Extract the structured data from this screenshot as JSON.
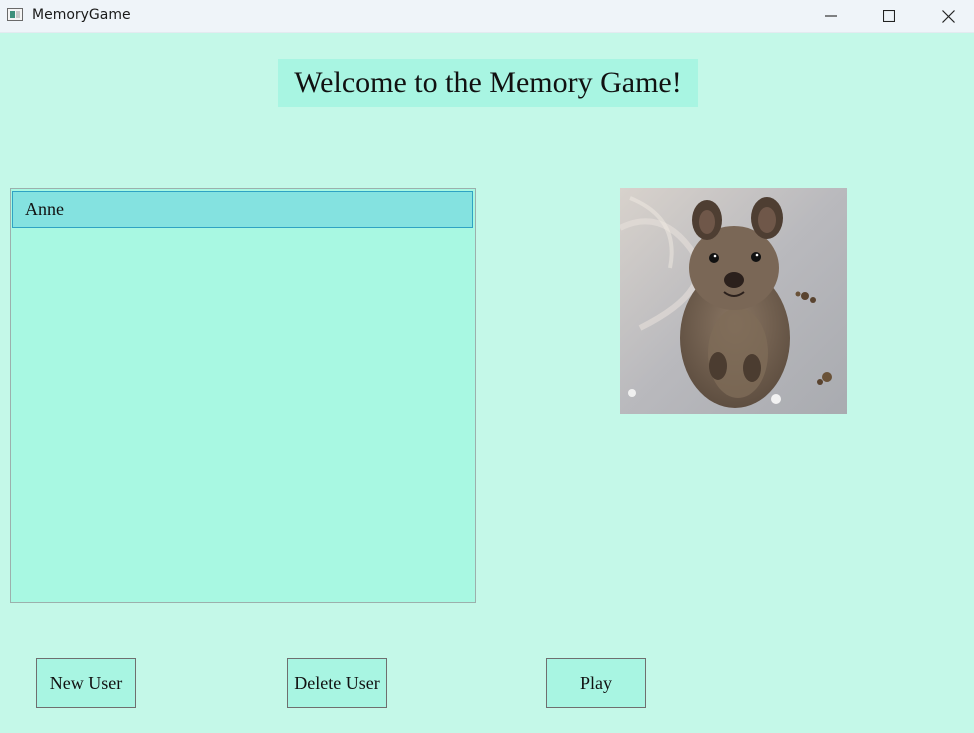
{
  "window": {
    "title": "MemoryGame",
    "app_icon": "memorygame-app-icon",
    "controls": {
      "minimize": "minimize-icon",
      "maximize": "maximize-icon",
      "close": "close-icon"
    }
  },
  "header": {
    "title": "Welcome to the Memory Game!"
  },
  "user_list": {
    "items": [
      {
        "label": "Anne",
        "selected": true
      }
    ]
  },
  "image": {
    "subject": "quokka"
  },
  "buttons": {
    "new_user": "New User",
    "delete_user": "Delete User",
    "play": "Play"
  },
  "colors": {
    "background": "#c4f8e8",
    "panel": "#a8f8e2",
    "selected_item": "#84e2e0",
    "selected_border": "#2fa3c4",
    "title_bar": "#eff4f9"
  }
}
